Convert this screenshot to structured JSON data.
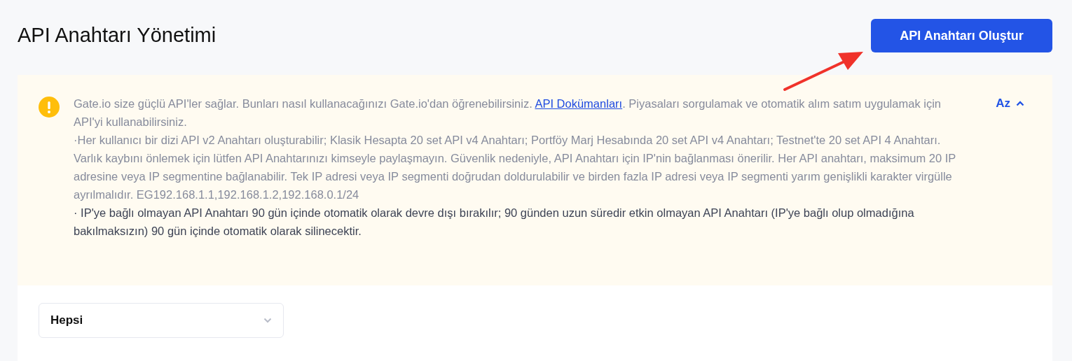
{
  "page_title": "API Anahtarı Yönetimi",
  "create_button": "API Anahtarı Oluştur",
  "notice": {
    "toggle": "Az",
    "expanded": true,
    "paragraphs": [
      {
        "before": "Gate.io size güçlü API'ler sağlar. Bunları nasıl kullanacağınızı Gate.io'dan öğrenebilirsiniz. ",
        "link": "API Dokümanları",
        "after": ". Piyasaları sorgulamak ve otomatik alım satım uygulamak için API'yi kullanabilirsiniz.",
        "emphasis": false
      },
      {
        "before": "·Her kullanıcı bir dizi API v2 Anahtarı oluşturabilir; Klasik Hesapta 20 set API v4 Anahtarı; Portföy Marj Hesabında 20 set API v4 Anahtarı; Testnet'te 20 set API 4 Anahtarı.",
        "emphasis": false
      },
      {
        "before": "Varlık kaybını önlemek için lütfen API Anahtarınızı kimseyle paylaşmayın. Güvenlik nedeniyle, API Anahtarı için IP'nin bağlanması önerilir. Her API anahtarı, maksimum 20 IP adresine veya IP segmentine bağlanabilir. Tek IP adresi veya IP segmenti doğrudan doldurulabilir ve birden fazla IP adresi veya IP segmenti yarım genişlikli karakter virgülle ayrılmalıdır. EG192.168.1.1,192.168.1.2,192.168.0.1/24",
        "emphasis": false
      },
      {
        "before": "· IP'ye bağlı olmayan API Anahtarı 90 gün içinde otomatik olarak devre dışı bırakılır; 90 günden uzun süredir etkin olmayan API Anahtarı (IP'ye bağlı olup olmadığına bakılmaksızın) 90 gün içinde otomatik olarak silinecektir.",
        "emphasis": true
      }
    ]
  },
  "filter": {
    "value": "Hepsi"
  }
}
